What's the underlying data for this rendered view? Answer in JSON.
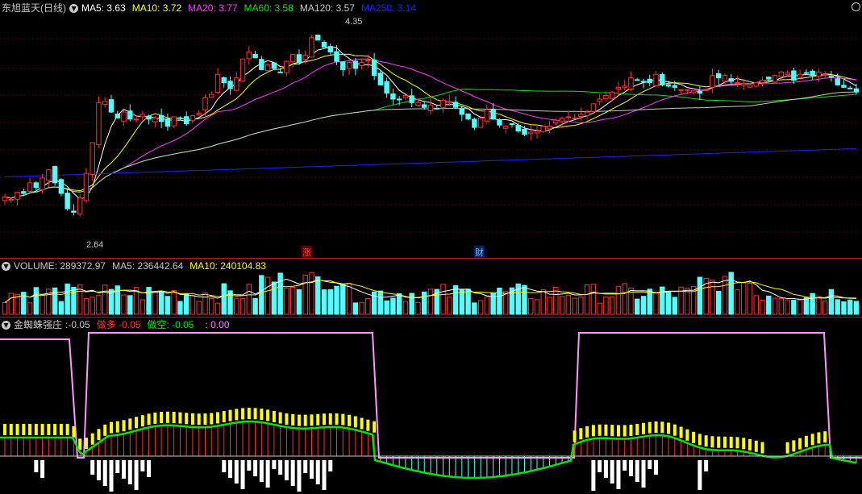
{
  "stock": {
    "name": "东旭蓝天",
    "period": "(日线)"
  },
  "ma": [
    {
      "label": "MA5:",
      "value": "3.63",
      "color": "#ffffff"
    },
    {
      "label": "MA10:",
      "value": "3.72",
      "color": "#ffff00"
    },
    {
      "label": "MA20:",
      "value": "3.77",
      "color": "#ff3cff"
    },
    {
      "label": "MA60:",
      "value": "3.58",
      "color": "#00e600"
    },
    {
      "label": "MA120:",
      "value": "3.57",
      "color": "#c8c8c8"
    },
    {
      "label": "MA250:",
      "value": "3.14",
      "color": "#2020ff"
    }
  ],
  "price_marks": {
    "high": "4.35",
    "low": "2.64"
  },
  "events": {
    "zhang": "涨",
    "cai": "财"
  },
  "volume": {
    "label": "VOLUME:",
    "value": "289372.97",
    "ma5_label": "MA5:",
    "ma5": "236442.64",
    "ma10_label": "MA10:",
    "ma10": "240104.83"
  },
  "indicator": {
    "name": "金蜘蛛强庄",
    "main_label": ":",
    "main_value": "-0.05",
    "long_label": "做多",
    "long_value": "-0.05",
    "short_label": "做空:",
    "short_value": "-0.05",
    "extra_label": ":",
    "extra_value": "0.00"
  },
  "colors": {
    "up": "#ff3232",
    "down": "#54ffff",
    "bg": "#000000",
    "sep": "#b01818"
  },
  "icons": {
    "collapse": "circle-chevron-down-icon",
    "window": "circle-icon"
  },
  "chart_data": {
    "type": "candlestick",
    "ylim": [
      2.55,
      4.45
    ],
    "closes": [
      2.93,
      2.91,
      2.97,
      2.96,
      3.05,
      3.01,
      3.09,
      3.16,
      3.05,
      2.96,
      2.83,
      2.8,
      2.92,
      3.13,
      3.39,
      3.73,
      3.74,
      3.65,
      3.6,
      3.65,
      3.59,
      3.59,
      3.63,
      3.59,
      3.6,
      3.57,
      3.53,
      3.61,
      3.6,
      3.55,
      3.62,
      3.64,
      3.77,
      3.8,
      3.97,
      3.9,
      3.85,
      3.94,
      4.1,
      4.16,
      4.11,
      4.01,
      4.05,
      4.02,
      3.99,
      4.08,
      4.14,
      4.07,
      4.13,
      4.28,
      4.26,
      4.2,
      4.16,
      4.08,
      4.01,
      4.07,
      4.02,
      4.07,
      4.09,
      3.96,
      3.88,
      3.81,
      3.76,
      3.76,
      3.79,
      3.73,
      3.73,
      3.69,
      3.71,
      3.68,
      3.75,
      3.74,
      3.69,
      3.63,
      3.59,
      3.52,
      3.6,
      3.67,
      3.59,
      3.54,
      3.53,
      3.55,
      3.49,
      3.46,
      3.48,
      3.49,
      3.53,
      3.53,
      3.58,
      3.6,
      3.61,
      3.6,
      3.63,
      3.65,
      3.72,
      3.76,
      3.79,
      3.82,
      3.86,
      3.87,
      3.94,
      3.92,
      3.91,
      3.9,
      3.97,
      3.88,
      3.87,
      3.86,
      3.84,
      3.84,
      3.83,
      3.81,
      3.84,
      3.96,
      3.94,
      3.96,
      3.91,
      3.9,
      3.89,
      3.88,
      3.9,
      3.92,
      3.93,
      3.96,
      3.99,
      3.98,
      3.92,
      3.97,
      3.98,
      3.96,
      3.99,
      3.97,
      3.95,
      3.88,
      3.86,
      3.85,
      3.82
    ]
  }
}
